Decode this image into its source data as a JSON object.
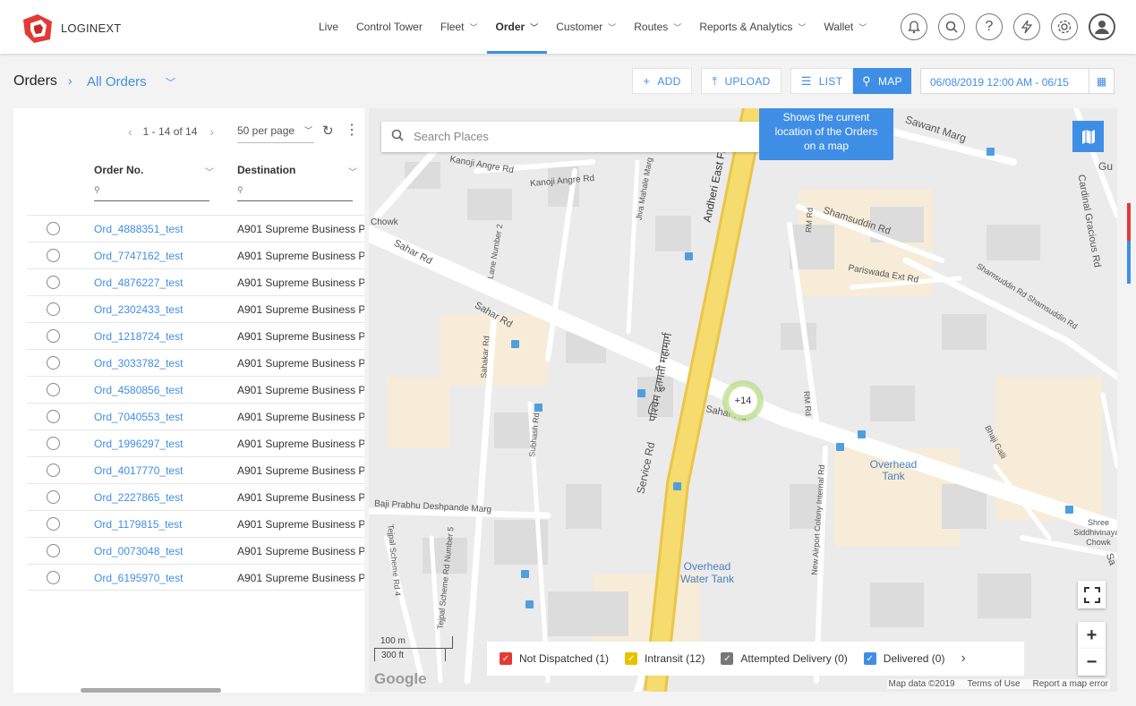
{
  "brand": {
    "name": "LOGINEXT"
  },
  "nav": [
    {
      "label": "Live",
      "dropdown": false,
      "active": false
    },
    {
      "label": "Control Tower",
      "dropdown": false,
      "active": false
    },
    {
      "label": "Fleet",
      "dropdown": true,
      "active": false
    },
    {
      "label": "Order",
      "dropdown": true,
      "active": true
    },
    {
      "label": "Customer",
      "dropdown": true,
      "active": false
    },
    {
      "label": "Routes",
      "dropdown": true,
      "active": false
    },
    {
      "label": "Reports & Analytics",
      "dropdown": true,
      "active": false
    },
    {
      "label": "Wallet",
      "dropdown": true,
      "active": false
    }
  ],
  "top_icons": [
    "bell-icon",
    "search-icon",
    "help-icon",
    "bolt-icon",
    "settings-icon",
    "user-icon"
  ],
  "breadcrumb": {
    "root": "Orders",
    "current": "All Orders"
  },
  "actions": {
    "add": "ADD",
    "upload": "UPLOAD",
    "list": "LIST",
    "map": "MAP"
  },
  "date_range": "06/08/2019 12:00 AM - 06/15",
  "pager": {
    "range": "1 - 14 of 14",
    "per_page": "50 per page"
  },
  "columns": {
    "order_no": "Order No.",
    "destination": "Destination"
  },
  "orders": [
    {
      "id": "Ord_4888351_test",
      "destination": "A901 Supreme Business P"
    },
    {
      "id": "Ord_7747162_test",
      "destination": "A901 Supreme Business P"
    },
    {
      "id": "Ord_4876227_test",
      "destination": "A901 Supreme Business P"
    },
    {
      "id": "Ord_2302433_test",
      "destination": "A901 Supreme Business P"
    },
    {
      "id": "Ord_1218724_test",
      "destination": "A901 Supreme Business P"
    },
    {
      "id": "Ord_3033782_test",
      "destination": "A901 Supreme Business P"
    },
    {
      "id": "Ord_4580856_test",
      "destination": "A901 Supreme Business P"
    },
    {
      "id": "Ord_7040553_test",
      "destination": "A901 Supreme Business P"
    },
    {
      "id": "Ord_1996297_test",
      "destination": "A901 Supreme Business P"
    },
    {
      "id": "Ord_4017770_test",
      "destination": "A901 Supreme Business P"
    },
    {
      "id": "Ord_2227865_test",
      "destination": "A901 Supreme Business P"
    },
    {
      "id": "Ord_1179815_test",
      "destination": "A901 Supreme Business P"
    },
    {
      "id": "Ord_0073048_test",
      "destination": "A901 Supreme Business P"
    },
    {
      "id": "Ord_6195970_test",
      "destination": "A901 Supreme Business P"
    }
  ],
  "map": {
    "search_placeholder": "Search Places",
    "tooltip": "Shows the current location of the Orders on a map",
    "cluster_count": "+14",
    "legend": [
      {
        "label": "Not Dispatched (1)",
        "color": "#e53935"
      },
      {
        "label": "Intransit (12)",
        "color": "#e6c300"
      },
      {
        "label": "Attempted Delivery (0)",
        "color": "#777777"
      },
      {
        "label": "Delivered (0)",
        "color": "#3f8ee6"
      }
    ],
    "scale": {
      "metric": "100 m",
      "imperial": "300 ft"
    },
    "google": "Google",
    "attribution": [
      "Map data ©2019",
      "Terms of Use",
      "Report a map error"
    ],
    "labels": {
      "sahar_rd_1": "Sahar Rd",
      "sahar_rd_2": "Sahar Rd",
      "sahar_rd_3": "Sahar Rd",
      "andheri": "Andheri East Fl",
      "sawant": "Sawant Marg",
      "shamsuddin": "Shamsuddin Rd",
      "pariswada": "Pariswada Ext Rd",
      "cardinal": "Cardinal Gracious Rd",
      "kanoji1": "Kanoji Angre Rd",
      "kanoji2": "Kanoji Angre Rd",
      "overhead1": "Overhead Tank",
      "overhead2": "Overhead Water Tank",
      "baji": "Baji Prabhu Deshpande Marg",
      "service": "Service Rd",
      "chowk": "Chowk",
      "shree": "Shree Siddhivinayak Chowk",
      "airport": "New Airport Colony Internal Rd",
      "subhash": "Subhash Rd",
      "sahakar": "Sahakar Rd",
      "bhaji": "Bhaji Galli",
      "rm1": "RM Rd",
      "rm2": "RM Rd",
      "hindi": "पश्चिम द्रुतगती महामार्ग",
      "jiva": "Jiva Mahale Marg",
      "lane2": "Lane Number 2",
      "tejpal": "Tejpal Scheme Rd 4",
      "tejpal5": "Tejpal Scheme Rd Number 5",
      "gu": "Gu",
      "sa": "Sa",
      "shamsuddin2": "Shamsuddin Rd Shamsuddin Rd"
    }
  }
}
